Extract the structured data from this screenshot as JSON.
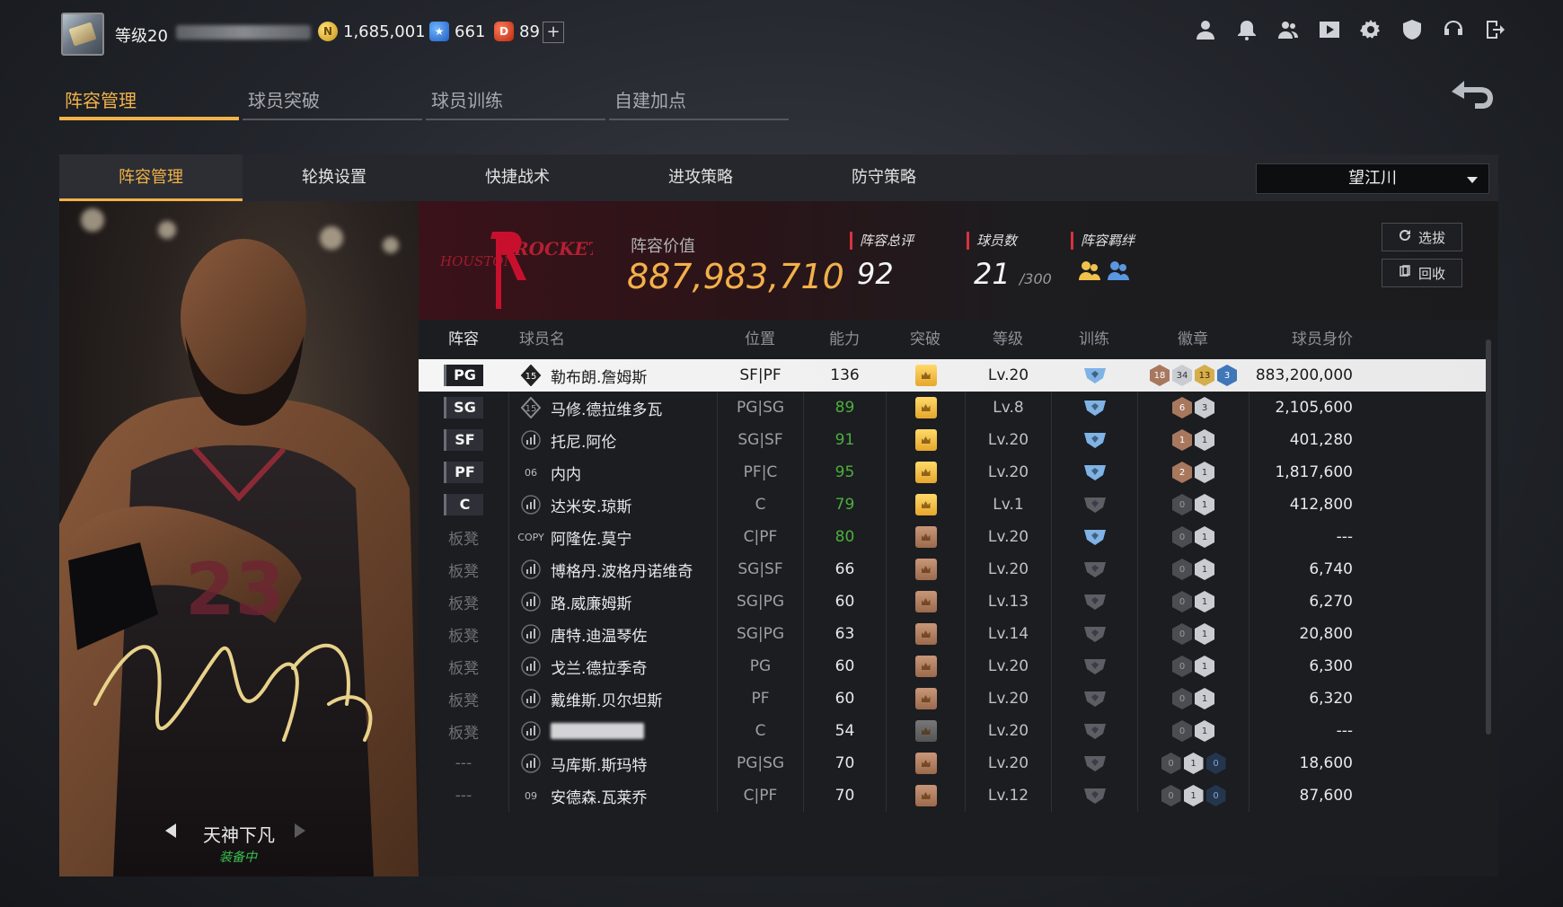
{
  "topbar": {
    "level_label": "等级20",
    "gold": "1,685,001",
    "stars": "661",
    "tokens": "89",
    "plus": "+",
    "icons": [
      "person-icon",
      "bell-icon",
      "friends-icon",
      "video-icon",
      "gear-icon",
      "shield-icon",
      "headset-icon",
      "exit-icon"
    ]
  },
  "main_tabs": [
    "阵容管理",
    "球员突破",
    "球员训练",
    "自建加点"
  ],
  "sub_tabs": [
    "阵容管理",
    "轮换设置",
    "快捷战术",
    "进攻策略",
    "防守策略"
  ],
  "team_select": "望江川",
  "card": {
    "skin_name": "天神下凡",
    "status": "装备中"
  },
  "summary": {
    "value_label": "阵容价值",
    "value": "887,983,710",
    "rating_label": "阵容总评",
    "rating": "92",
    "players_label": "球员数",
    "players": "21",
    "players_max": "/300",
    "bond_label": "阵容羁绊",
    "btn_scout": "选拔",
    "btn_recycle": "回收"
  },
  "columns": [
    "阵容",
    "球员名",
    "位置",
    "能力",
    "突破",
    "等级",
    "训练",
    "徽章",
    "球员身价"
  ],
  "rows": [
    {
      "slot": "PG",
      "name": "勒布朗.詹姆斯",
      "tier": "15",
      "pos": "SF|PF",
      "ability": "136",
      "level": "Lv.20",
      "value": "883,200,000",
      "badges": [
        "18",
        "34",
        "13",
        "3"
      ]
    },
    {
      "slot": "SG",
      "name": "马修.德拉维多瓦",
      "tier": "15",
      "pos": "PG|SG",
      "ability": "89",
      "level": "Lv.8",
      "value": "2,105,600",
      "badges": [
        "6",
        "3"
      ]
    },
    {
      "slot": "SF",
      "name": "托尼.阿伦",
      "tier": "",
      "pos": "SG|SF",
      "ability": "91",
      "level": "Lv.20",
      "value": "401,280",
      "badges": [
        "1",
        "1"
      ]
    },
    {
      "slot": "PF",
      "name": "内内",
      "tier": "06",
      "pos": "PF|C",
      "ability": "95",
      "level": "Lv.20",
      "value": "1,817,600",
      "badges": [
        "2",
        "1"
      ]
    },
    {
      "slot": "C",
      "name": "达米安.琼斯",
      "tier": "",
      "pos": "C",
      "ability": "79",
      "level": "Lv.1",
      "value": "412,800",
      "badges": [
        "0",
        "1"
      ]
    },
    {
      "slot": "板凳",
      "name": "阿隆佐.莫宁",
      "tier": "COPY",
      "pos": "C|PF",
      "ability": "80",
      "level": "Lv.20",
      "value": "---",
      "badges": [
        "0",
        "1"
      ]
    },
    {
      "slot": "板凳",
      "name": "博格丹.波格丹诺维奇",
      "tier": "",
      "pos": "SG|SF",
      "ability": "66",
      "level": "Lv.20",
      "value": "6,740",
      "badges": [
        "0",
        "1"
      ]
    },
    {
      "slot": "板凳",
      "name": "路.威廉姆斯",
      "tier": "",
      "pos": "SG|PG",
      "ability": "60",
      "level": "Lv.13",
      "value": "6,270",
      "badges": [
        "0",
        "1"
      ]
    },
    {
      "slot": "板凳",
      "name": "唐特.迪温琴佐",
      "tier": "",
      "pos": "SG|PG",
      "ability": "63",
      "level": "Lv.14",
      "value": "20,800",
      "badges": [
        "0",
        "1"
      ]
    },
    {
      "slot": "板凳",
      "name": "戈兰.德拉季奇",
      "tier": "",
      "pos": "PG",
      "ability": "60",
      "level": "Lv.20",
      "value": "6,300",
      "badges": [
        "0",
        "1"
      ]
    },
    {
      "slot": "板凳",
      "name": "戴维斯.贝尔坦斯",
      "tier": "",
      "pos": "PF",
      "ability": "60",
      "level": "Lv.20",
      "value": "6,320",
      "badges": [
        "0",
        "1"
      ]
    },
    {
      "slot": "板凳",
      "name": "",
      "tier": "",
      "pos": "C",
      "ability": "54",
      "level": "Lv.20",
      "value": "---",
      "badges": [
        "0",
        "1"
      ]
    },
    {
      "slot": "---",
      "name": "马库斯.斯玛特",
      "tier": "",
      "pos": "PG|SG",
      "ability": "70",
      "level": "Lv.20",
      "value": "18,600",
      "badges": [
        "0",
        "1",
        "0"
      ]
    },
    {
      "slot": "---",
      "name": "安德森.瓦莱乔",
      "tier": "09",
      "pos": "C|PF",
      "ability": "70",
      "level": "Lv.12",
      "value": "87,600",
      "badges": [
        "0",
        "1",
        "0"
      ]
    }
  ],
  "colors": {
    "accent": "#f2b24a",
    "green": "#4cae3c",
    "rocketsRed": "#c8102e"
  }
}
